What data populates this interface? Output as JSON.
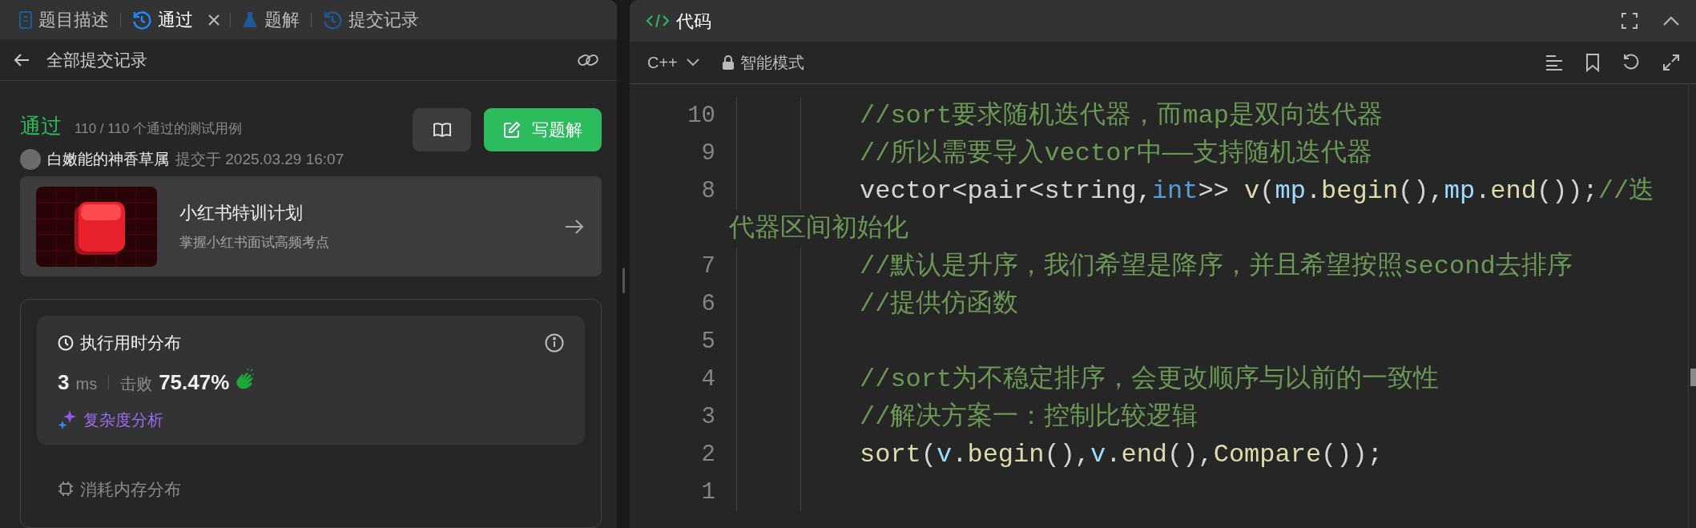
{
  "tabs": [
    {
      "label": "题目描述",
      "selected": false,
      "closable": false
    },
    {
      "label": "通过",
      "selected": true,
      "closable": true
    },
    {
      "label": "题解",
      "selected": false,
      "closable": false
    },
    {
      "label": "提交记录",
      "selected": false,
      "closable": false
    }
  ],
  "subheader": {
    "title": "全部提交记录"
  },
  "result": {
    "status": "通过",
    "cases": "110 / 110 个通过的测试用例",
    "user": "白嫩能的神香草属",
    "submitted": "提交于 2025.03.29 16:07",
    "write_button": "写题解"
  },
  "promo": {
    "title": "小红书特训计划",
    "subtitle": "掌握小红书面试高频考点"
  },
  "runtime": {
    "title": "执行用时分布",
    "value": "3",
    "unit": "ms",
    "beats_label": "击败",
    "beats": "75.47%",
    "analysis": "复杂度分析"
  },
  "memory": {
    "title": "消耗内存分布"
  },
  "editor": {
    "title": "代码",
    "language": "C++",
    "mode": "智能模式",
    "lines": [
      {
        "kind": "line",
        "number": "10",
        "tokens": [
          {
            "kind": "comment",
            "text": "//sort要求随机迭代器，而map是双向迭代器"
          }
        ]
      },
      {
        "kind": "line",
        "number": "9",
        "tokens": [
          {
            "kind": "comment",
            "text": "//所以需要导入vector中——支持随机迭代器"
          }
        ]
      },
      {
        "kind": "line",
        "number": "8",
        "tokens": [
          {
            "kind": "plain",
            "text": "vector<pair<string,"
          },
          {
            "kind": "keyword",
            "text": "int"
          },
          {
            "kind": "plain",
            "text": ">> "
          },
          {
            "kind": "function",
            "text": "v"
          },
          {
            "kind": "plain",
            "text": "("
          },
          {
            "kind": "variable",
            "text": "mp"
          },
          {
            "kind": "plain",
            "text": "."
          },
          {
            "kind": "function",
            "text": "begin"
          },
          {
            "kind": "plain",
            "text": "(),"
          },
          {
            "kind": "variable",
            "text": "mp"
          },
          {
            "kind": "plain",
            "text": "."
          },
          {
            "kind": "function",
            "text": "end"
          },
          {
            "kind": "plain",
            "text": "());"
          },
          {
            "kind": "comment",
            "text": "//迭"
          }
        ]
      },
      {
        "kind": "wrap",
        "tokens": [
          {
            "kind": "comment",
            "text": "代器区间初始化"
          }
        ]
      },
      {
        "kind": "line",
        "number": "7",
        "tokens": [
          {
            "kind": "comment",
            "text": "//默认是升序，我们希望是降序，并且希望按照second去排序"
          }
        ]
      },
      {
        "kind": "line",
        "number": "6",
        "tokens": [
          {
            "kind": "comment",
            "text": "//提供仿函数"
          }
        ]
      },
      {
        "kind": "line",
        "number": "5"
      },
      {
        "kind": "line",
        "number": "4",
        "tokens": [
          {
            "kind": "comment",
            "text": "//sort为不稳定排序，会更改顺序与以前的一致性"
          }
        ]
      },
      {
        "kind": "line",
        "number": "3",
        "tokens": [
          {
            "kind": "comment",
            "text": "//解决方案一：控制比较逻辑"
          }
        ]
      },
      {
        "kind": "line",
        "number": "2",
        "tokens": [
          {
            "kind": "function",
            "text": "sort"
          },
          {
            "kind": "plain",
            "text": "("
          },
          {
            "kind": "variable",
            "text": "v"
          },
          {
            "kind": "plain",
            "text": "."
          },
          {
            "kind": "function",
            "text": "begin"
          },
          {
            "kind": "plain",
            "text": "(),"
          },
          {
            "kind": "variable",
            "text": "v"
          },
          {
            "kind": "plain",
            "text": "."
          },
          {
            "kind": "function",
            "text": "end"
          },
          {
            "kind": "plain",
            "text": "(),"
          },
          {
            "kind": "function",
            "text": "Compare"
          },
          {
            "kind": "plain",
            "text": "());"
          }
        ]
      },
      {
        "kind": "line",
        "number": "1"
      }
    ]
  }
}
